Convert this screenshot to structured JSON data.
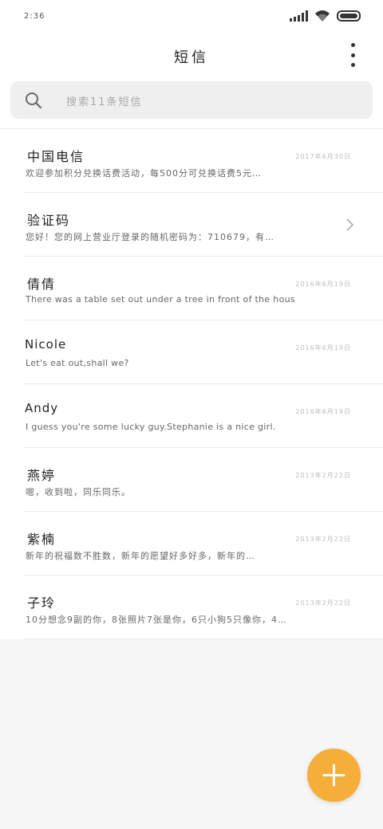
{
  "status_bar": {
    "time": "2:36",
    "icons": [
      "signal-icon",
      "wifi-icon",
      "battery-icon"
    ]
  },
  "header": {
    "title": "短信",
    "menu_icon": "more-vertical-icon"
  },
  "search": {
    "placeholder": "搜索11条短信",
    "icon": "search-icon"
  },
  "conversations": [
    {
      "name": "中国电信",
      "date": "2017年6月30日",
      "preview": "欢迎参加积分兑换话费活动，每500分可兑换话费5元…"
    },
    {
      "name": "验证码",
      "date": "",
      "preview": "您好！您的网上营业厅登录的随机密码为：710679，有…"
    },
    {
      "name": "倩倩",
      "date": "2016年6月19日",
      "preview": "There was a table set out under a tree in front of the hous"
    },
    {
      "name": "Nicole",
      "date": "2016年6月19日",
      "preview": "Let's eat out,shall we?"
    },
    {
      "name": "Andy",
      "date": "2016年6月19日",
      "preview": "I guess you're some lucky guy.Stephanie is a nice girl."
    },
    {
      "name": "燕婷",
      "date": "2013年2月22日",
      "preview": "嗯，收到啦，同乐同乐。"
    },
    {
      "name": "紫楠",
      "date": "2013年2月22日",
      "preview": "新年的祝福数不胜数，新年的愿望好多好多，新年的…"
    },
    {
      "name": "子玲",
      "date": "2013年2月22日",
      "preview": "10分想念9副的你，8张照片7张是你，6只小狗5只像你，4…"
    }
  ],
  "colors": {
    "fab": "#f6ae3b",
    "background": "#f6f6f6",
    "surface": "#ffffff"
  },
  "fab": {
    "icon": "plus-icon"
  }
}
